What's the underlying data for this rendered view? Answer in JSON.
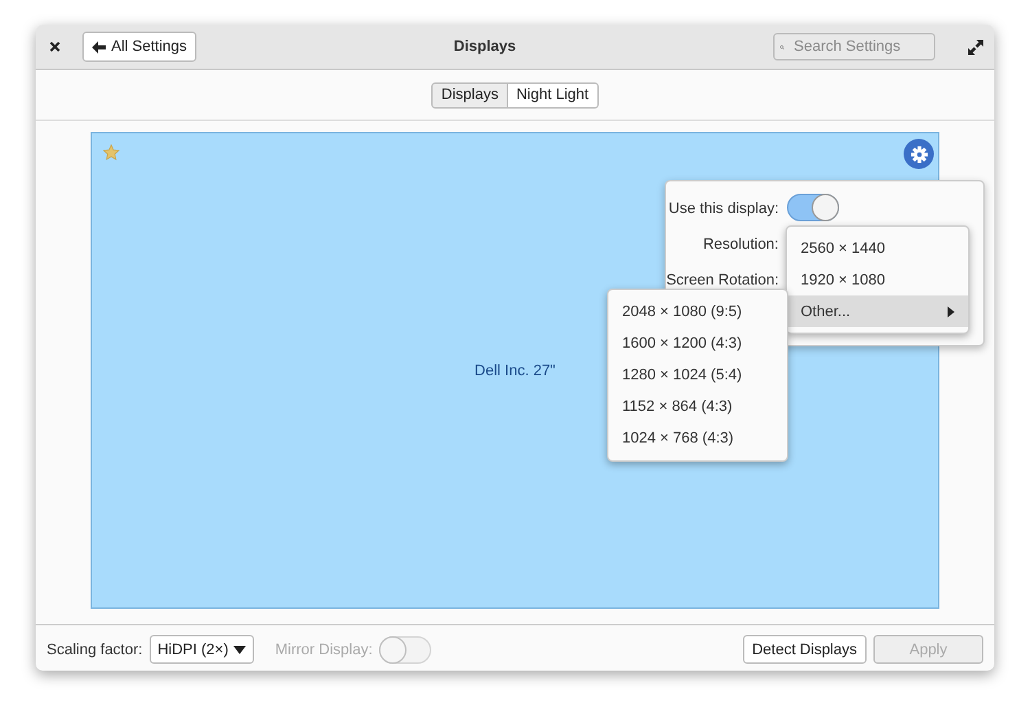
{
  "window": {
    "title": "Displays",
    "back_button": "All Settings",
    "search": {
      "placeholder": "Search Settings"
    }
  },
  "tabs": [
    {
      "label": "Displays",
      "selected": true
    },
    {
      "label": "Night Light",
      "selected": false
    }
  ],
  "display": {
    "name": "Dell Inc. 27\"",
    "primary": true
  },
  "popover": {
    "use_display": {
      "label": "Use this display:",
      "on": true
    },
    "resolution_label": "Resolution:",
    "rotation_label": "Screen Rotation:",
    "resolution_menu": [
      {
        "label": "2560 × 1440",
        "selected": false,
        "submenu": false
      },
      {
        "label": "1920 × 1080",
        "selected": false,
        "submenu": false
      },
      {
        "label": "Other...",
        "selected": true,
        "submenu": true
      }
    ],
    "other_menu": [
      "2048 × 1080 (9:5)",
      "1600 × 1200 (4:3)",
      "1280 × 1024 (5:4)",
      "1152 × 864 (4:3)",
      "1024 × 768 (4:3)"
    ]
  },
  "footer": {
    "scaling_label": "Scaling factor:",
    "scaling_value": "HiDPI (2×)",
    "mirror": {
      "label": "Mirror Display:",
      "on": false,
      "disabled": true
    },
    "detect_button": "Detect Displays",
    "apply_button": {
      "label": "Apply",
      "disabled": true
    }
  }
}
